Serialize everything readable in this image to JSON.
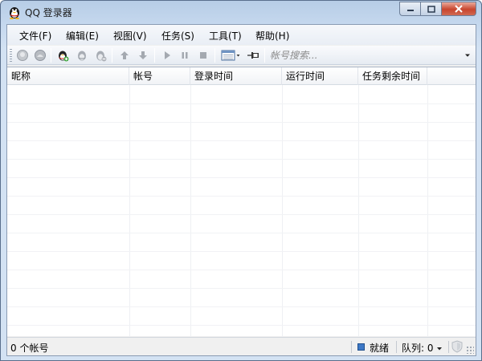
{
  "window": {
    "title": "QQ 登录器"
  },
  "menu": [
    {
      "id": "file",
      "label": "文件(F)"
    },
    {
      "id": "edit",
      "label": "编辑(E)"
    },
    {
      "id": "view",
      "label": "视图(V)"
    },
    {
      "id": "task",
      "label": "任务(S)"
    },
    {
      "id": "tools",
      "label": "工具(T)"
    },
    {
      "id": "help",
      "label": "帮助(H)"
    }
  ],
  "toolbar": {
    "icons": [
      "login-icon",
      "logout-icon",
      "add-account-icon",
      "edit-account-icon",
      "delete-account-icon",
      "move-up-icon",
      "move-down-icon",
      "start-icon",
      "pause-icon",
      "stop-icon",
      "view-mode-icon",
      "pin-icon"
    ],
    "search_placeholder": "帐号搜索..."
  },
  "list": {
    "columns": [
      "昵称",
      "帐号",
      "登录时间",
      "运行时间",
      "任务剩余时间"
    ],
    "rows": []
  },
  "status": {
    "count_text": "0 个帐号",
    "ready_text": "就绪",
    "queue_text": "队列: 0"
  },
  "colors": {
    "titlebar": "#c5d8ee",
    "close_button": "#c8452e",
    "ready_indicator": "#3d78c6"
  }
}
